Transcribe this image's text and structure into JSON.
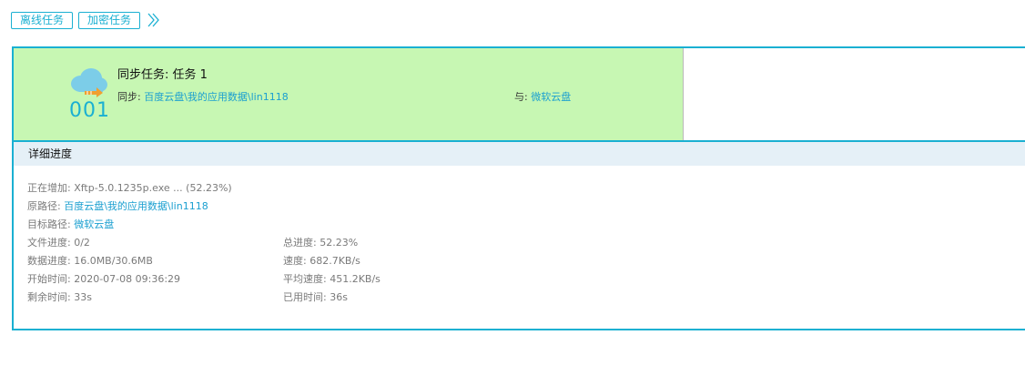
{
  "toolbar": {
    "tabs": [
      {
        "label": "离线任务"
      },
      {
        "label": "加密任务"
      }
    ],
    "more_icon": "double-chevron-right-icon"
  },
  "task": {
    "number": "001",
    "icon": "cloud-sync-icon",
    "title": "同步任务: 任务 1",
    "sync_label": "同步:",
    "sync_source": "百度云盘\\我的应用数据\\lin1118",
    "with_label": "与:",
    "with_target": "微软云盘"
  },
  "detail": {
    "header": "详细进度",
    "adding_label": "正在增加:",
    "adding_value": "Xftp-5.0.1235p.exe ... (52.23%)",
    "source_path_label": "原路径:",
    "source_path_value": "百度云盘\\我的应用数据\\lin1118",
    "target_path_label": "目标路径:",
    "target_path_value": "微软云盘",
    "file_progress": "文件进度: 0/2",
    "total_progress": "总进度: 52.23%",
    "data_progress": "数据进度: 16.0MB/30.6MB",
    "speed": "速度: 682.7KB/s",
    "start_time": "开始时间: 2020-07-08 09:36:29",
    "avg_speed": "平均速度: 451.2KB/s",
    "remaining_time": "剩余时间: 33s",
    "elapsed_time": "已用时间: 36s"
  },
  "colors": {
    "accent": "#1ab0d2",
    "summary_bg": "#c7f7b3",
    "detail_header_bg": "#e5f0f7",
    "link": "#1a9fd0",
    "icon_orange": "#f0a030"
  }
}
